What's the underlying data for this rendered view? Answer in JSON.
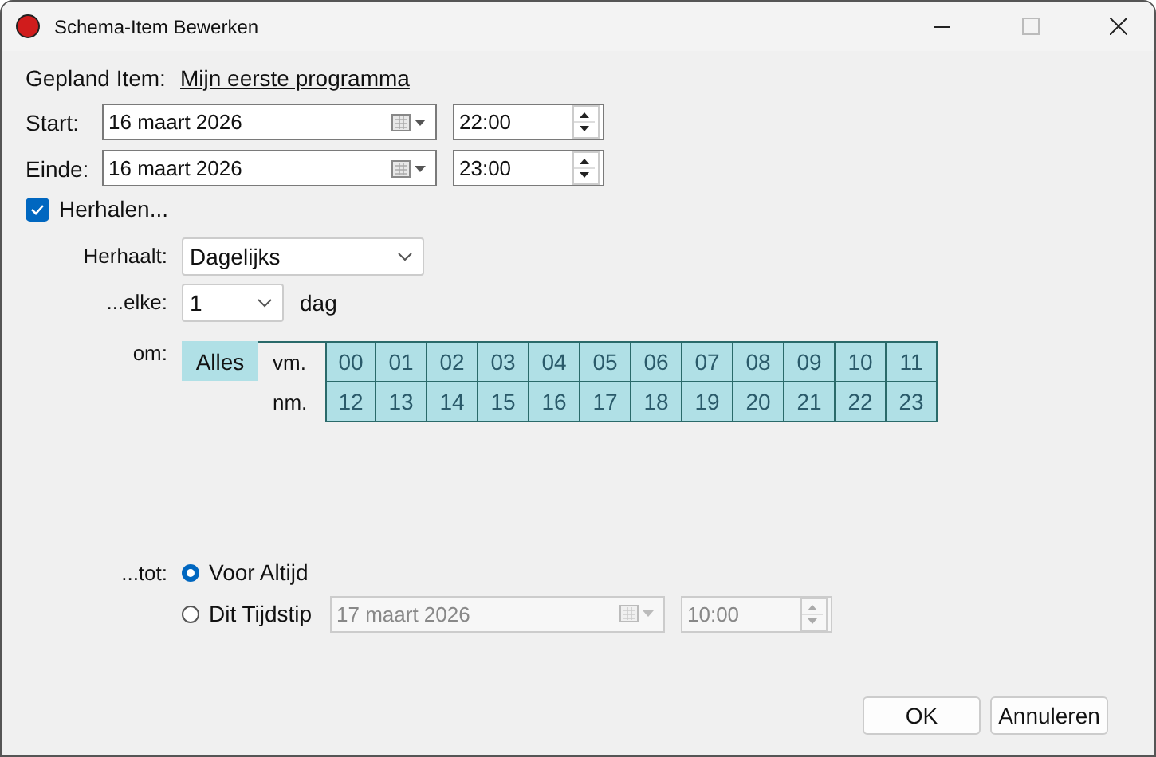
{
  "window": {
    "title": "Schema-Item Bewerken"
  },
  "scheduled_item": {
    "label": "Gepland Item:",
    "link": "Mijn eerste programma"
  },
  "start": {
    "label": "Start:",
    "date": "16 maart 2026",
    "time": "22:00"
  },
  "end": {
    "label": "Einde:",
    "date": "16 maart 2026",
    "time": "23:00"
  },
  "repeat": {
    "label": "Herhalen...",
    "checked": true
  },
  "repeats": {
    "label": "Herhaalt:",
    "value": "Dagelijks"
  },
  "every": {
    "label": "...elke:",
    "value": "1",
    "unit": "dag"
  },
  "at": {
    "label": "om:",
    "all_button": "Alles",
    "rows": [
      {
        "label": "vm.",
        "hours": [
          {
            "text": "00",
            "selected": true
          },
          {
            "text": "01",
            "selected": true
          },
          {
            "text": "02",
            "selected": true
          },
          {
            "text": "03",
            "selected": true
          },
          {
            "text": "04",
            "selected": true
          },
          {
            "text": "05",
            "selected": true
          },
          {
            "text": "06",
            "selected": true
          },
          {
            "text": "07",
            "selected": true
          },
          {
            "text": "08",
            "selected": true
          },
          {
            "text": "09",
            "selected": true
          },
          {
            "text": "10",
            "selected": true
          },
          {
            "text": "11",
            "selected": true
          }
        ]
      },
      {
        "label": "nm.",
        "hours": [
          {
            "text": "12",
            "selected": true
          },
          {
            "text": "13",
            "selected": true
          },
          {
            "text": "14",
            "selected": true
          },
          {
            "text": "15",
            "selected": true
          },
          {
            "text": "16",
            "selected": true
          },
          {
            "text": "17",
            "selected": true
          },
          {
            "text": "18",
            "selected": true
          },
          {
            "text": "19",
            "selected": true
          },
          {
            "text": "20",
            "selected": true
          },
          {
            "text": "21",
            "selected": true
          },
          {
            "text": "22",
            "selected": true
          },
          {
            "text": "23",
            "selected": true
          }
        ]
      }
    ]
  },
  "until": {
    "label": "...tot:",
    "options": [
      {
        "label": "Voor Altijd",
        "selected": true
      },
      {
        "label": "Dit Tijdstip",
        "selected": false,
        "date": "17 maart 2026",
        "time": "10:00"
      }
    ]
  },
  "buttons": [
    "OK",
    "Annuleren"
  ]
}
